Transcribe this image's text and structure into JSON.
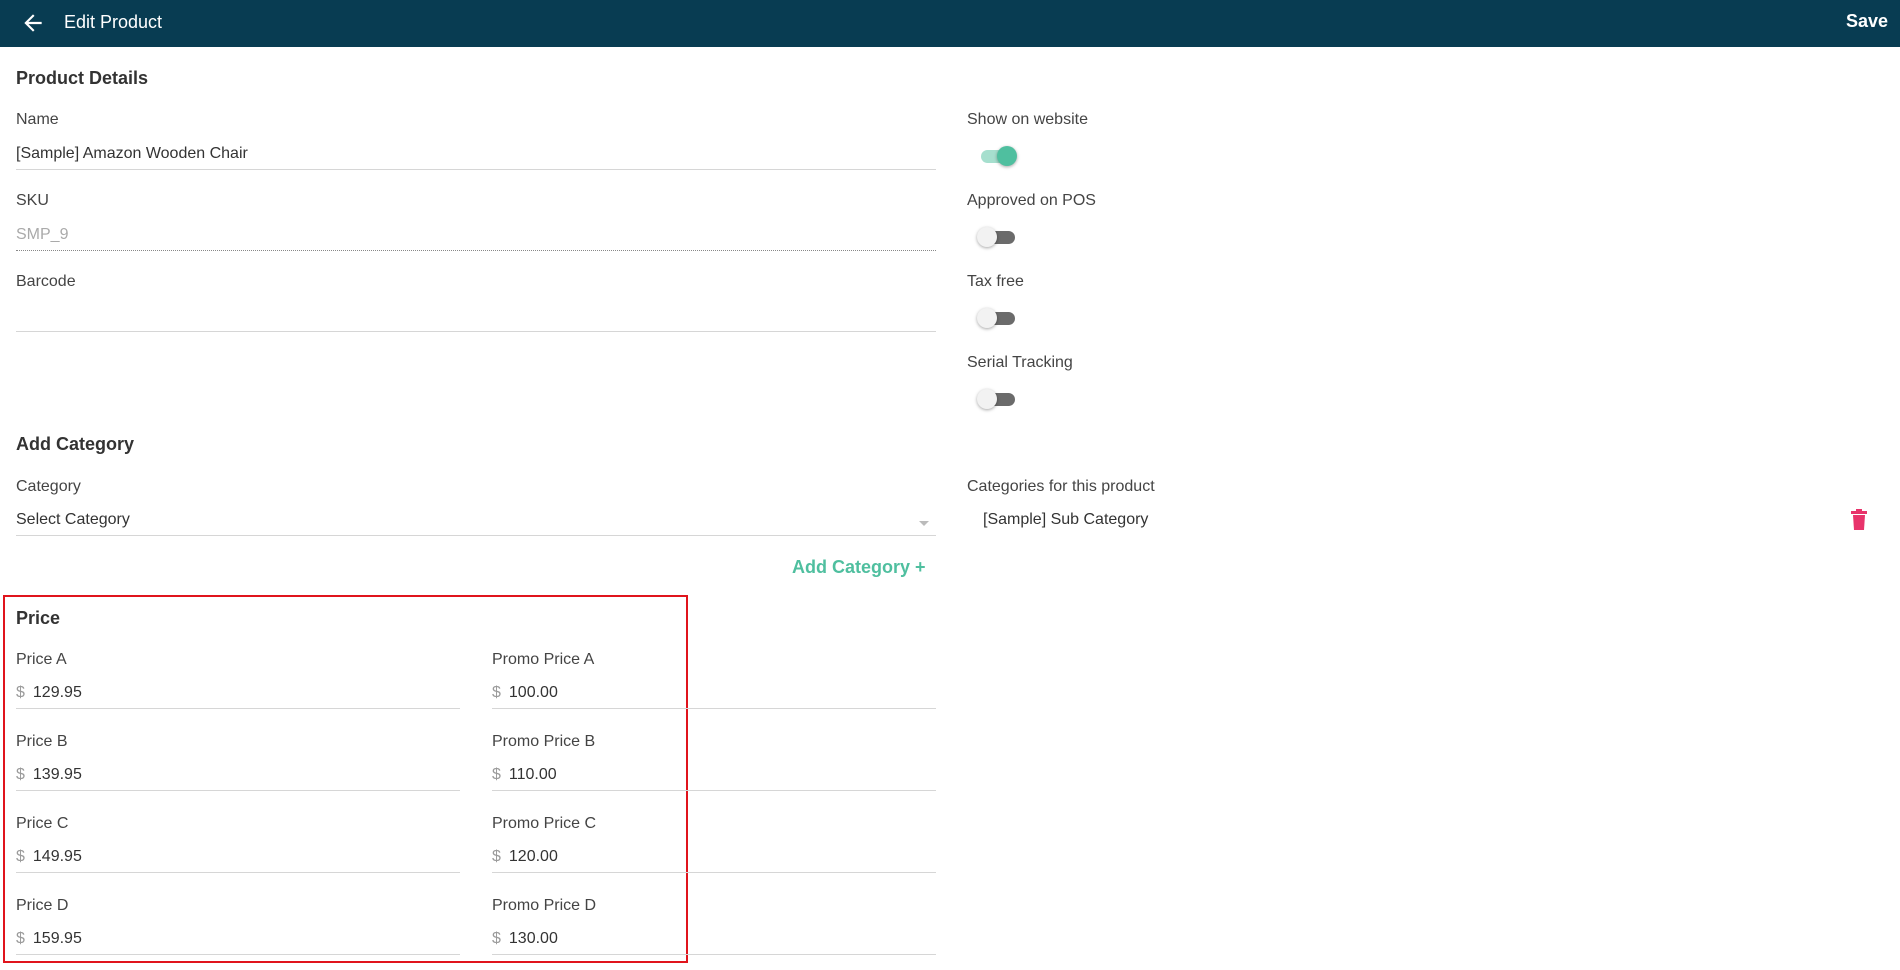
{
  "header": {
    "title": "Edit Product",
    "save_label": "Save"
  },
  "product_details": {
    "title": "Product Details",
    "name_label": "Name",
    "name_value": "[Sample] Amazon Wooden Chair",
    "sku_label": "SKU",
    "sku_value": "SMP_9",
    "barcode_label": "Barcode",
    "barcode_value": ""
  },
  "toggles": [
    {
      "label": "Show on website",
      "on": true
    },
    {
      "label": "Approved on POS",
      "on": false
    },
    {
      "label": "Tax free",
      "on": false
    },
    {
      "label": "Serial Tracking",
      "on": false
    }
  ],
  "category": {
    "title": "Add Category",
    "label": "Category",
    "select_value": "Select Category",
    "add_label": "Add Category +",
    "assigned_label": "Categories for this product",
    "assigned": [
      "[Sample] Sub Category"
    ]
  },
  "price": {
    "title": "Price",
    "currency": "$",
    "prices": [
      {
        "label": "Price A",
        "value": "129.95"
      },
      {
        "label": "Price B",
        "value": "139.95"
      },
      {
        "label": "Price C",
        "value": "149.95"
      },
      {
        "label": "Price D",
        "value": "159.95"
      }
    ],
    "promo_prices": [
      {
        "label": "Promo Price A",
        "value": "100.00"
      },
      {
        "label": "Promo Price B",
        "value": "110.00"
      },
      {
        "label": "Promo Price C",
        "value": "120.00"
      },
      {
        "label": "Promo Price D",
        "value": "130.00"
      }
    ]
  },
  "colors": {
    "header_bg": "#083c52",
    "accent": "#4fbf9f",
    "delete": "#e8336b",
    "highlight_border": "#e0141c"
  },
  "icons": {
    "back": "arrow-left-icon",
    "dropdown": "chevron-down-icon",
    "delete": "trash-icon"
  }
}
